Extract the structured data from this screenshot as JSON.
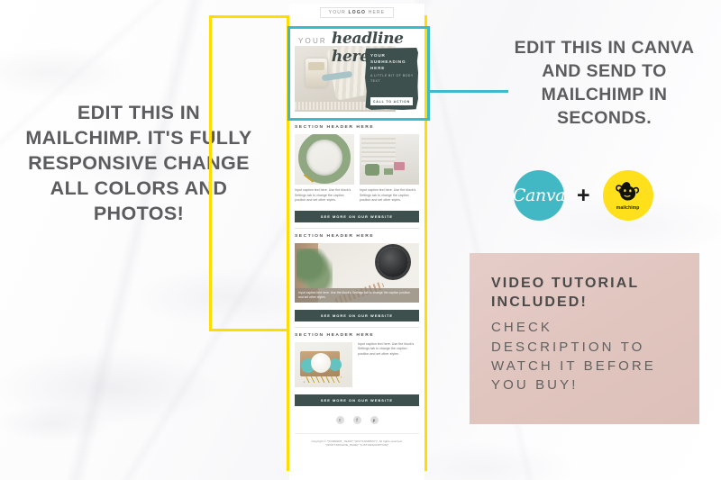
{
  "colors": {
    "yellow": "#FFDD00",
    "teal": "#3DBBCE",
    "pink": "#E0C4BE",
    "dark_green": "#3D504E",
    "canva_blue": "#42B8C4",
    "mailchimp_yellow": "#FFE01B",
    "text_gray": "#5B5C5E"
  },
  "left_blurb": "EDIT THIS IN MAILCHIMP. IT'S FULLY RESPONSIVE CHANGE ALL COLORS AND PHOTOS!",
  "right_blurb": "EDIT THIS IN CANVA AND SEND TO MAILCHIMP IN SECONDS.",
  "logos": {
    "canva_label": "Canva",
    "plus": "+",
    "mailchimp_label": "mailchimp"
  },
  "pink_callout": {
    "title": "VIDEO TUTORIAL INCLUDED!",
    "body": "CHECK DESCRIPTION TO WATCH IT BEFORE YOU BUY!"
  },
  "email": {
    "logo_pre": "YOUR ",
    "logo_strong": "LOGO",
    "logo_post": " HERE",
    "hero": {
      "pre_title": "YOUR",
      "script_title": "headline here",
      "subheading": "YOUR SUBHEADING HERE",
      "body_text": "A LITTLE BIT OF BODY TEXT",
      "cta": "CALL TO ACTION"
    },
    "section_header": "SECTION HEADER HERE",
    "caption": "Input caption text here. Use the block's Settings tab to change the caption position and set other styles.",
    "caption_overlay": "Input caption text here. Use the block's Settings tab to change the caption position and set other styles.",
    "button": "SEE MORE ON OUR WEBSITE",
    "social": [
      "t",
      "f",
      "p"
    ],
    "copyright_line1": "Copyright © *|CURRENT_YEAR|* *|LIST:COMPANY|*, All rights reserved.",
    "copyright_line2": "*|IFNOT:ARCHIVE_PAGE|* *|LIST:DESCRIPTION|*"
  }
}
